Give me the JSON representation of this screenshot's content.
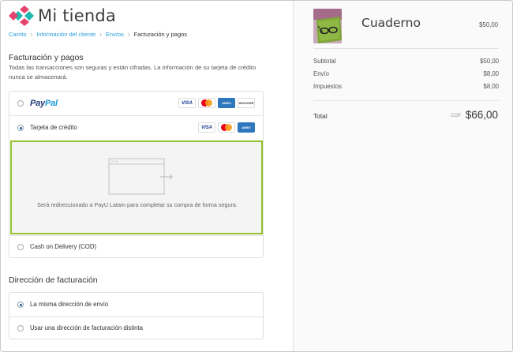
{
  "store": {
    "name": "Mi tienda",
    "logo_icon": "diamond-cross-logo-icon",
    "colors": {
      "pink": "#e5446d",
      "teal": "#21b8b0"
    }
  },
  "breadcrumb": {
    "items": [
      "Carrito",
      "Información del cliente",
      "Envíos"
    ],
    "current": "Facturación y pagos"
  },
  "payment": {
    "title": "Facturación y pagos",
    "description": "Todas las transacciones son seguras y están cifradas. La información de su tarjeta de crédito nunca se almacenará.",
    "options": {
      "paypal": {
        "brand_part1": "Pay",
        "brand_part2": "Pal",
        "selected": false,
        "cards": [
          "VISA",
          "mastercard",
          "AMERICAN EXPRESS",
          "DISCOVER"
        ]
      },
      "credit_card": {
        "label": "Tarjeta de crédito",
        "selected": true,
        "cards": [
          "VISA",
          "mastercard",
          "AMERICAN EXPRESS"
        ]
      },
      "cod": {
        "label": "Cash on Delivery (COD)",
        "selected": false
      }
    },
    "redirect_text": "Será redireccionado a PayU Latam para completar su compra de forma segura.",
    "accent_color": "#92c22e"
  },
  "billing": {
    "title": "Dirección de facturación",
    "options": [
      {
        "label": "La misma dirección de envío",
        "selected": true
      },
      {
        "label": "Usar una dirección de facturación distinta",
        "selected": false
      }
    ]
  },
  "summary": {
    "product": {
      "name": "Cuaderno",
      "price": "$50,00",
      "thumb_icon": "notebook-with-glasses-thumbnail"
    },
    "lines": [
      {
        "label": "Subtotal",
        "value": "$50,00"
      },
      {
        "label": "Envío",
        "value": "$8,00"
      },
      {
        "label": "Impuestos",
        "value": "$8,00"
      }
    ],
    "total": {
      "label": "Total",
      "currency": "COP",
      "value": "$66,00"
    }
  }
}
